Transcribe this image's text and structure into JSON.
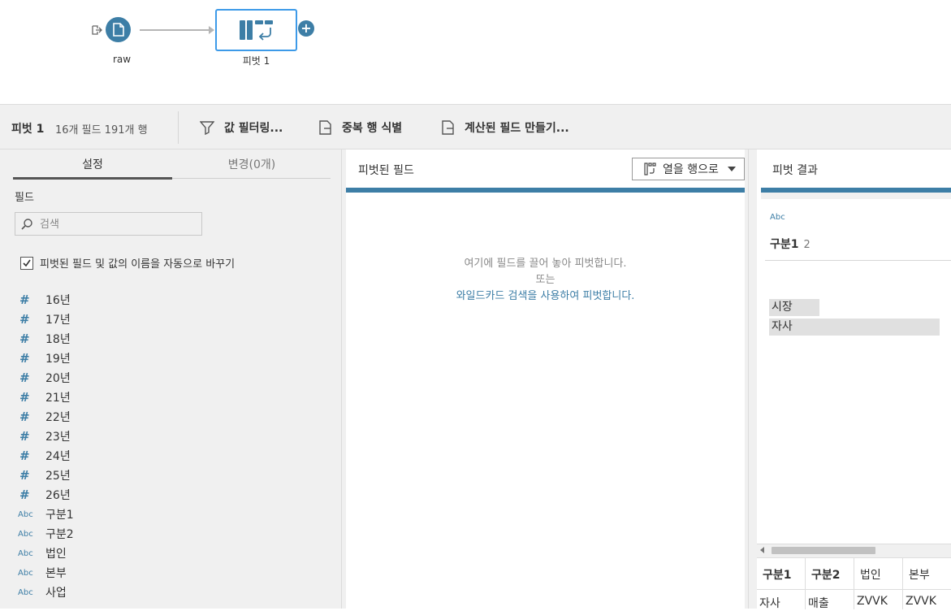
{
  "flow": {
    "input_node_label": "raw",
    "pivot_node_label": "피벗 1",
    "add_label": "+"
  },
  "toolbar": {
    "step_name": "피벗 1",
    "meta": "16개 필드  191개 행",
    "filter_label": "값 필터링...",
    "dedupe_label": "중복 행 식별",
    "calc_label": "계산된 필드 만들기..."
  },
  "settings": {
    "tab_settings": "설정",
    "tab_changes": "변경(0개)",
    "fields_label": "필드",
    "search_placeholder": "검색",
    "auto_rename_label": "피벗된 필드 및 값의 이름을 자동으로 바꾸기",
    "fields": [
      {
        "type": "#",
        "name": "16년"
      },
      {
        "type": "#",
        "name": "17년"
      },
      {
        "type": "#",
        "name": "18년"
      },
      {
        "type": "#",
        "name": "19년"
      },
      {
        "type": "#",
        "name": "20년"
      },
      {
        "type": "#",
        "name": "21년"
      },
      {
        "type": "#",
        "name": "22년"
      },
      {
        "type": "#",
        "name": "23년"
      },
      {
        "type": "#",
        "name": "24년"
      },
      {
        "type": "#",
        "name": "25년"
      },
      {
        "type": "#",
        "name": "26년"
      },
      {
        "type": "Abc",
        "name": "구분1"
      },
      {
        "type": "Abc",
        "name": "구분2"
      },
      {
        "type": "Abc",
        "name": "법인"
      },
      {
        "type": "Abc",
        "name": "본부"
      },
      {
        "type": "Abc",
        "name": "사업"
      }
    ]
  },
  "pivoted": {
    "title": "피벗된 필드",
    "mode_dropdown": "열을 행으로",
    "hint_line1": "여기에 필드를 끌어 놓아 피벗합니다.",
    "hint_line2": "또는",
    "hint_link": "와일드카드 검색을 사용하여 피벗합니다."
  },
  "results": {
    "title": "피벗 결과",
    "field_type": "Abc",
    "field_name": "구분1",
    "field_count": "2",
    "values": [
      "시장",
      "자사"
    ]
  },
  "grid": {
    "headers": [
      "구분1",
      "구분2",
      "법인",
      "본부"
    ],
    "row1": [
      "자사",
      "매출",
      "ZVVK",
      "ZVVK"
    ]
  },
  "colors": {
    "accent": "#3d7ea6",
    "node_border": "#3d9ae8",
    "panel_bg": "#f0f0f0"
  }
}
